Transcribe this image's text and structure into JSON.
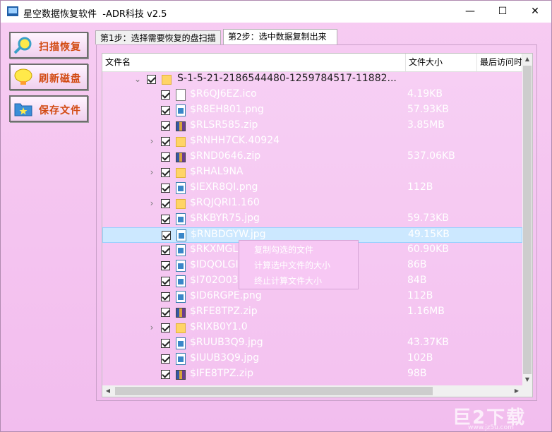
{
  "window": {
    "title": "星空数据恢复软件  -ADR科技 v2.5",
    "minimize_glyph": "—",
    "maximize_glyph": "☐",
    "close_glyph": "✕"
  },
  "left_buttons": [
    {
      "label": "扫描恢复",
      "icon": "magnifier-icon"
    },
    {
      "label": "刷新磁盘",
      "icon": "refresh-balloon-icon"
    },
    {
      "label": "保存文件",
      "icon": "save-folder-icon"
    }
  ],
  "tabs": [
    {
      "label": "第1步：选择需要恢复的盘扫描",
      "active": false
    },
    {
      "label": "第2步：选中数据复制出来",
      "active": true
    }
  ],
  "columns": {
    "name": "文件名",
    "size": "文件大小",
    "last_access": "最后访问时"
  },
  "tree": {
    "root_name": "S-1-5-21-2186544480-1259784517-11882...",
    "rows": [
      {
        "name": "$R6QJ6EZ.ico",
        "size": "4.19KB",
        "icon": "doc",
        "expander": false
      },
      {
        "name": "$R8EH801.png",
        "size": "57.93KB",
        "icon": "img",
        "expander": false
      },
      {
        "name": "$RLSR585.zip",
        "size": "3.85MB",
        "icon": "zip",
        "expander": false
      },
      {
        "name": "$RNHH7CK.40924",
        "size": "",
        "icon": "folder",
        "expander": true
      },
      {
        "name": "$RND0646.zip",
        "size": "537.06KB",
        "icon": "zip",
        "expander": false
      },
      {
        "name": "$RHAL9NA",
        "size": "",
        "icon": "folder",
        "expander": true
      },
      {
        "name": "$IEXR8QI.png",
        "size": "112B",
        "icon": "img",
        "expander": false
      },
      {
        "name": "$RQJQRI1.160",
        "size": "",
        "icon": "folder",
        "expander": true
      },
      {
        "name": "$RKBYR75.jpg",
        "size": "59.73KB",
        "icon": "img",
        "expander": false
      },
      {
        "name": "$RNBDGYW.jpg",
        "size": "49.15KB",
        "icon": "img",
        "expander": false,
        "selected": true
      },
      {
        "name": "$RKXMGL",
        "size": "60.90KB",
        "icon": "img",
        "expander": false
      },
      {
        "name": "$IDQOLGI",
        "size": "86B",
        "icon": "img",
        "expander": false
      },
      {
        "name": "$I702O03",
        "size": "84B",
        "icon": "img",
        "expander": false
      },
      {
        "name": "$ID6RGPE.png",
        "size": "112B",
        "icon": "img",
        "expander": false
      },
      {
        "name": "$RFE8TPZ.zip",
        "size": "1.16MB",
        "icon": "zip",
        "expander": false
      },
      {
        "name": "$RIXB0Y1.0",
        "size": "",
        "icon": "folder",
        "expander": true
      },
      {
        "name": "$RUUB3Q9.jpg",
        "size": "43.37KB",
        "icon": "img",
        "expander": false
      },
      {
        "name": "$IUUB3Q9.jpg",
        "size": "102B",
        "icon": "img",
        "expander": false
      },
      {
        "name": "$IFE8TPZ.zip",
        "size": "98B",
        "icon": "zip",
        "expander": false
      }
    ]
  },
  "context_menu": [
    {
      "label": "复制勾选的文件"
    },
    {
      "label": "计算选中文件的大小"
    },
    {
      "label": "终止计算文件大小"
    }
  ],
  "watermark": {
    "text": "巨2下载",
    "sub": "www.jz5u.com"
  }
}
